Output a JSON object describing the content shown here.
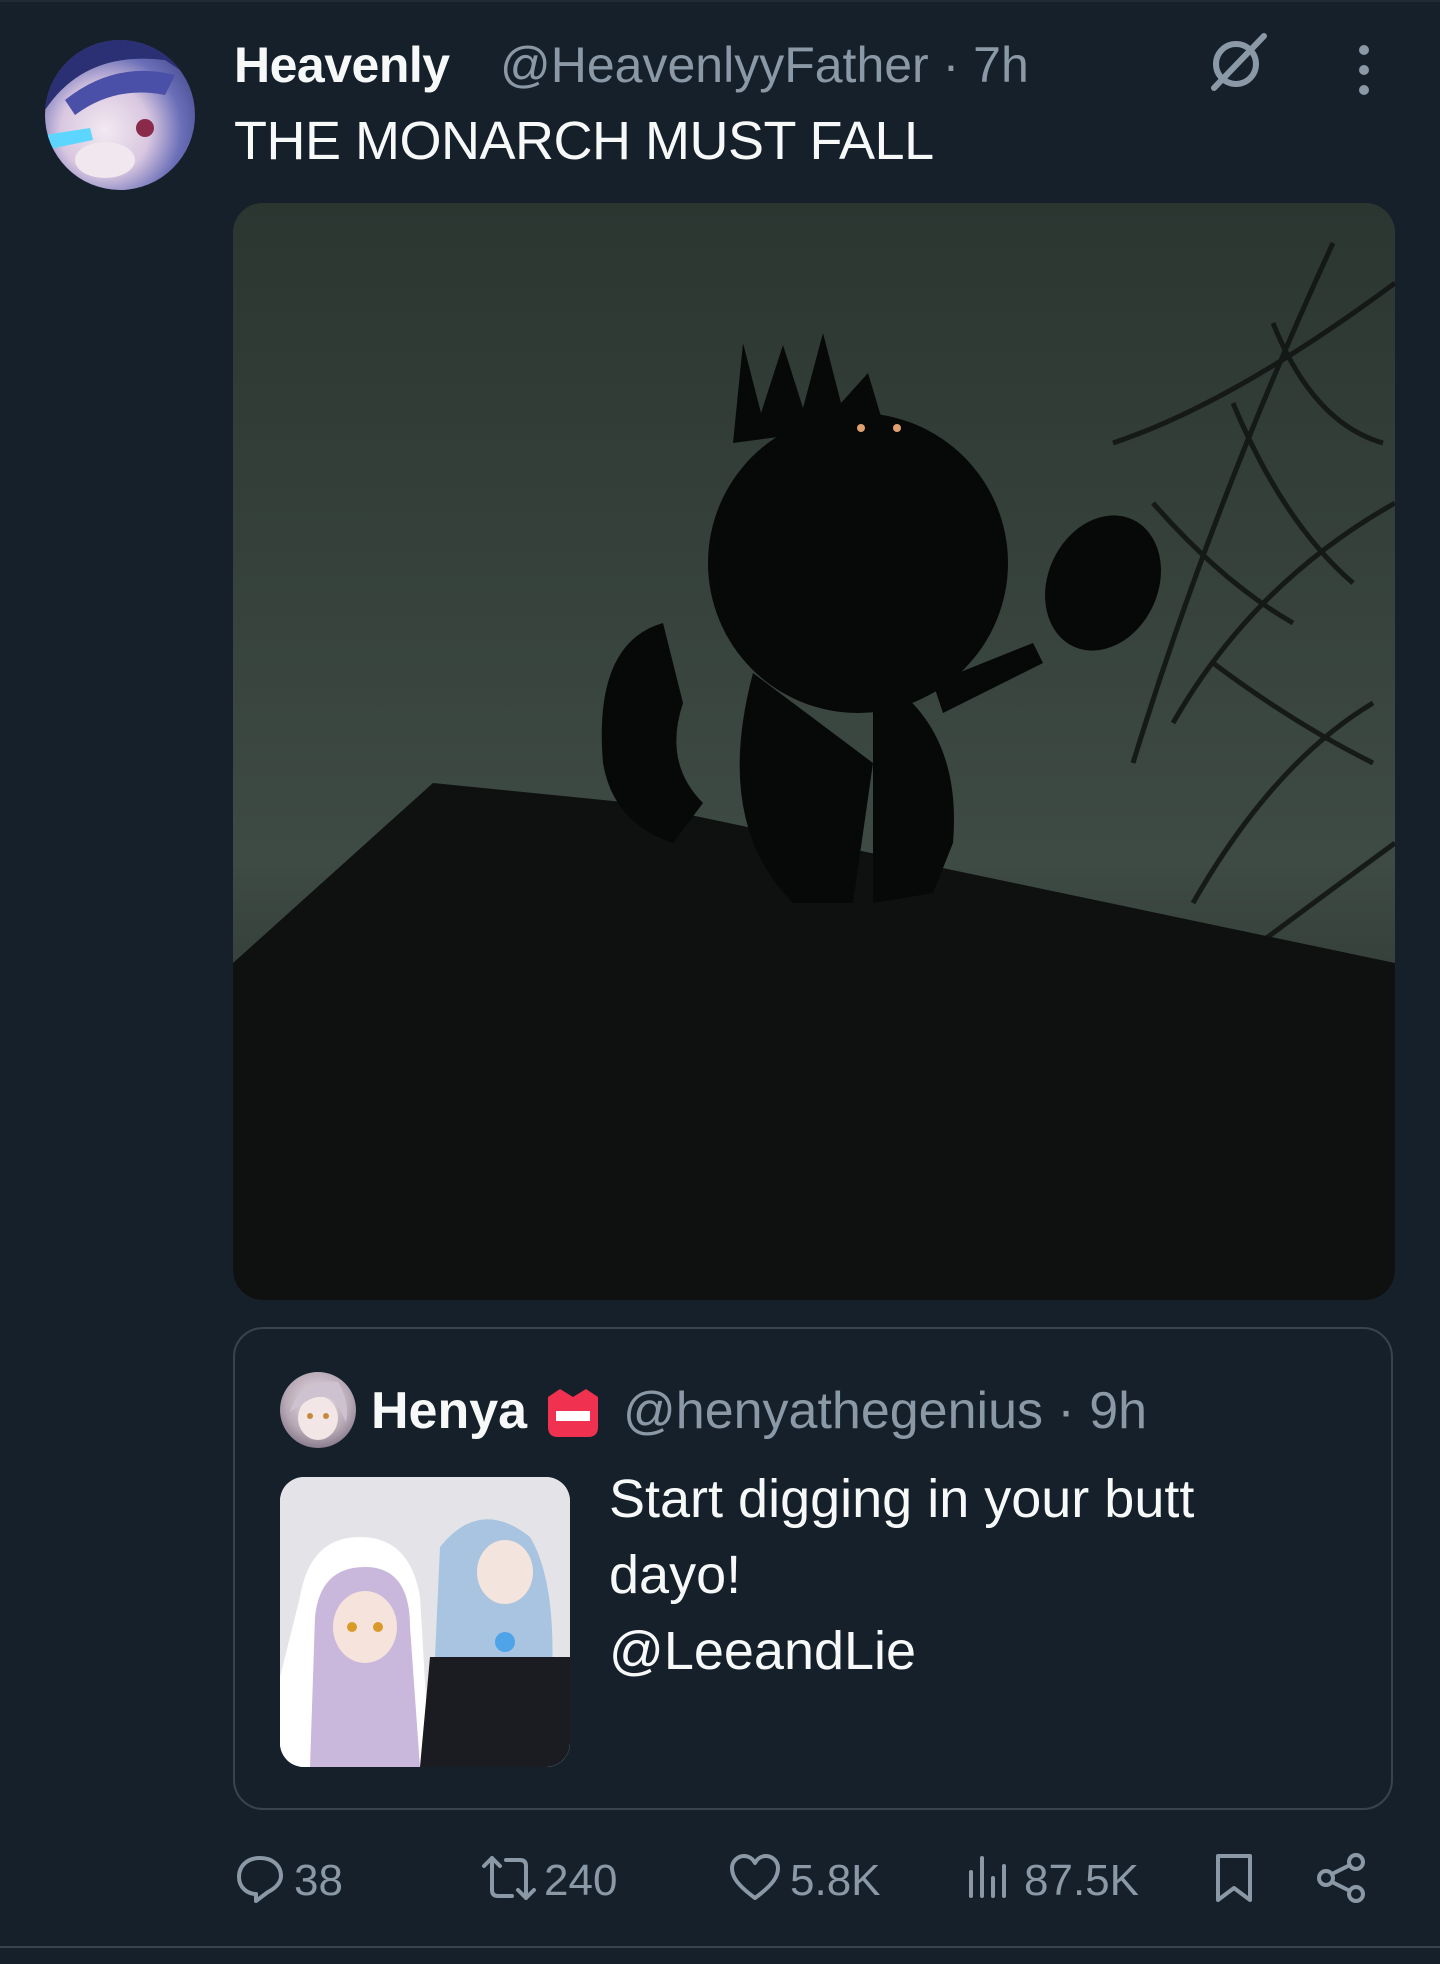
{
  "tweet": {
    "display_name": "Heavenly",
    "handle_time": "@HeavenlyyFather · 7h",
    "text": "THE MONARCH MUST FALL"
  },
  "quoted_tweet": {
    "display_name": "Henya",
    "handle_time": "@henyathegenius · 9h",
    "text_lines": [
      "Start digging in your butt",
      "dayo!",
      "@LeeandLie"
    ]
  },
  "actions": {
    "replies": "38",
    "reposts": "240",
    "likes": "5.8K",
    "views": "87.5K"
  },
  "icons": {
    "grok": "grok-icon",
    "more": "more-vertical-icon",
    "reply": "reply-icon",
    "repost": "repost-icon",
    "like": "heart-icon",
    "views": "views-chart-icon",
    "bookmark": "bookmark-icon",
    "share": "share-icon",
    "badge": "crown-badge-icon"
  },
  "colors": {
    "background": "#15202b",
    "text": "#f7f9f9",
    "muted": "#8b98a5",
    "border": "#38444d",
    "badge_red": "#f0314f"
  }
}
